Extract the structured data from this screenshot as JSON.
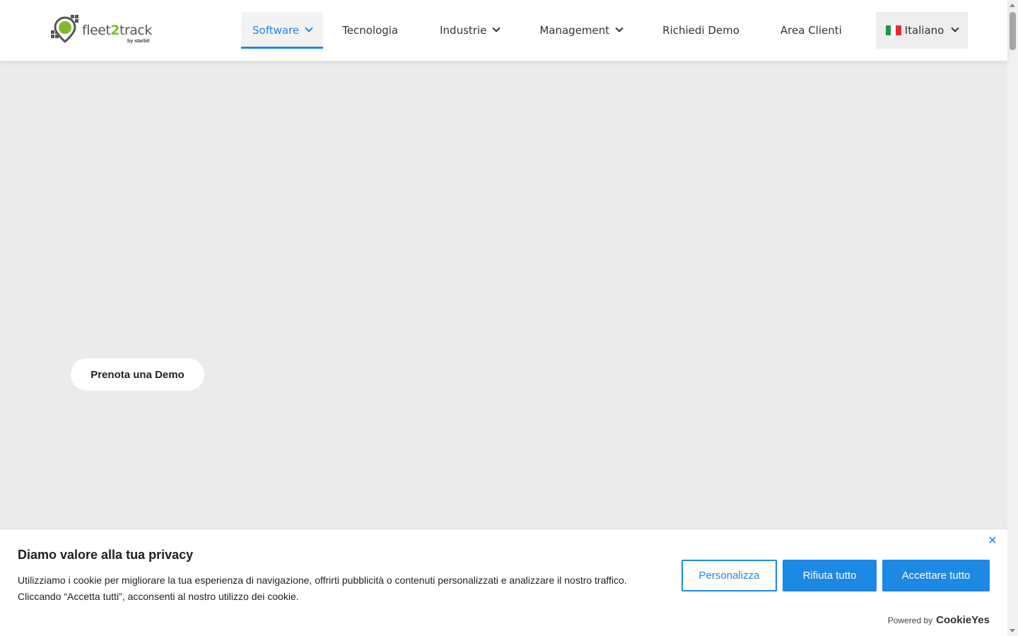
{
  "colors": {
    "accent": "#1e88e5",
    "logo_green": "#7dbb2d",
    "hero_bg": "#ebebeb"
  },
  "header": {
    "logo": {
      "part1": "fleet",
      "part2": "2",
      "part3": "track",
      "sub": "by starbit",
      "icon": "location-pin-logo-icon"
    },
    "nav": [
      {
        "label": "Software",
        "dropdown": true,
        "active": true
      },
      {
        "label": "Tecnologia",
        "dropdown": false
      },
      {
        "label": "Industrie",
        "dropdown": true
      },
      {
        "label": "Management",
        "dropdown": true
      },
      {
        "label": "Richiedi Demo",
        "dropdown": false
      },
      {
        "label": "Area Clienti",
        "dropdown": false
      }
    ],
    "language": {
      "label": "Italiano",
      "flag": "italy-flag-icon"
    }
  },
  "hero": {
    "cta_label": "Prenota una Demo"
  },
  "cookie_banner": {
    "title": "Diamo valore alla tua privacy",
    "text": "Utilizziamo i cookie per migliorare la tua esperienza di navigazione, offrirti pubblicità o contenuti personalizzati e analizzare il nostro traffico. Cliccando “Accetta tutti”, acconsenti al nostro utilizzo dei cookie.",
    "customize_label": "Personalizza",
    "reject_label": "Rifiuta tutto",
    "accept_label": "Accettare tutto",
    "powered_by": "Powered by",
    "powered_brand": "CookieYes",
    "close_icon": "close-icon"
  }
}
